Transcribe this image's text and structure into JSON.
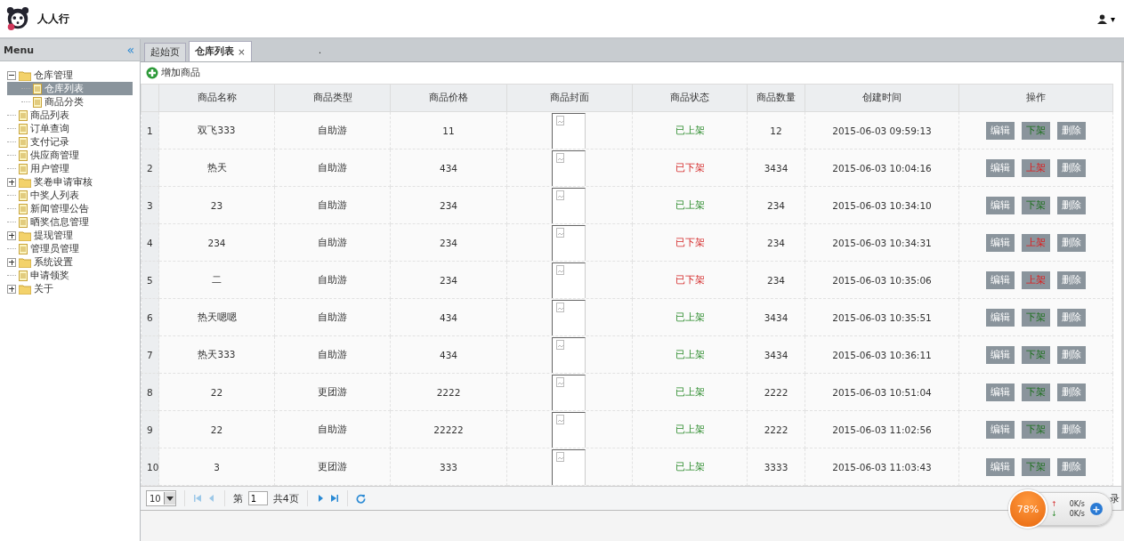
{
  "header": {
    "brand": "人人行",
    "user_caret": "▾"
  },
  "sidebar": {
    "title": "Menu",
    "collapse": "«",
    "tree": [
      {
        "label": "仓库管理",
        "kind": "folder",
        "expanded": true,
        "selected": false,
        "children": [
          {
            "label": "仓库列表",
            "kind": "file",
            "selected": true
          },
          {
            "label": "商品分类",
            "kind": "file",
            "selected": false
          }
        ]
      },
      {
        "label": "商品列表",
        "kind": "file",
        "selected": false
      },
      {
        "label": "订单查询",
        "kind": "file",
        "selected": false
      },
      {
        "label": "支付记录",
        "kind": "file",
        "selected": false
      },
      {
        "label": "供应商管理",
        "kind": "file",
        "selected": false
      },
      {
        "label": "用户管理",
        "kind": "file",
        "selected": false
      },
      {
        "label": "奖卷申请审核",
        "kind": "folder",
        "expanded": false,
        "selected": false
      },
      {
        "label": "中奖人列表",
        "kind": "file",
        "selected": false
      },
      {
        "label": "新闻管理公告",
        "kind": "file",
        "selected": false
      },
      {
        "label": "晒奖信息管理",
        "kind": "file",
        "selected": false
      },
      {
        "label": "提现管理",
        "kind": "folder",
        "expanded": false,
        "selected": false
      },
      {
        "label": "管理员管理",
        "kind": "file",
        "selected": false
      },
      {
        "label": "系统设置",
        "kind": "folder",
        "expanded": false,
        "selected": false
      },
      {
        "label": "申请领奖",
        "kind": "file",
        "selected": false
      },
      {
        "label": "关于",
        "kind": "folder",
        "expanded": false,
        "selected": false
      }
    ]
  },
  "tabs": [
    {
      "label": "起始页",
      "selected": false,
      "closable": false
    },
    {
      "label": "仓库列表",
      "selected": true,
      "closable": true,
      "close": "×"
    }
  ],
  "tab_dot": ".",
  "toolbar": {
    "add": "增加商品"
  },
  "table": {
    "columns": [
      "商品名称",
      "商品类型",
      "商品价格",
      "商品封面",
      "商品状态",
      "商品数量",
      "创建时间",
      "操作"
    ],
    "rows": [
      {
        "index": "1",
        "name": "双飞333",
        "type": "自助游",
        "price": "11",
        "status": "已上架",
        "on_shelf": true,
        "qty": "12",
        "created": "2015-06-03 09:59:13",
        "actions": [
          "编辑",
          "下架",
          "删除"
        ]
      },
      {
        "index": "2",
        "name": "热天",
        "type": "自助游",
        "price": "434",
        "status": "已下架",
        "on_shelf": false,
        "qty": "3434",
        "created": "2015-06-03 10:04:16",
        "actions": [
          "编辑",
          "上架",
          "删除"
        ]
      },
      {
        "index": "3",
        "name": "23",
        "type": "自助游",
        "price": "234",
        "status": "已上架",
        "on_shelf": true,
        "qty": "234",
        "created": "2015-06-03 10:34:10",
        "actions": [
          "编辑",
          "下架",
          "删除"
        ]
      },
      {
        "index": "4",
        "name": "234",
        "type": "自助游",
        "price": "234",
        "status": "已下架",
        "on_shelf": false,
        "qty": "234",
        "created": "2015-06-03 10:34:31",
        "actions": [
          "编辑",
          "上架",
          "删除"
        ]
      },
      {
        "index": "5",
        "name": "二",
        "type": "自助游",
        "price": "234",
        "status": "已下架",
        "on_shelf": false,
        "qty": "234",
        "created": "2015-06-03 10:35:06",
        "actions": [
          "编辑",
          "上架",
          "删除"
        ]
      },
      {
        "index": "6",
        "name": "热天嗯嗯",
        "type": "自助游",
        "price": "434",
        "status": "已上架",
        "on_shelf": true,
        "qty": "3434",
        "created": "2015-06-03 10:35:51",
        "actions": [
          "编辑",
          "下架",
          "删除"
        ]
      },
      {
        "index": "7",
        "name": "热天333",
        "type": "自助游",
        "price": "434",
        "status": "已上架",
        "on_shelf": true,
        "qty": "3434",
        "created": "2015-06-03 10:36:11",
        "actions": [
          "编辑",
          "下架",
          "删除"
        ]
      },
      {
        "index": "8",
        "name": "22",
        "type": "更团游",
        "price": "2222",
        "status": "已上架",
        "on_shelf": true,
        "qty": "2222",
        "created": "2015-06-03 10:51:04",
        "actions": [
          "编辑",
          "下架",
          "删除"
        ]
      },
      {
        "index": "9",
        "name": "22",
        "type": "自助游",
        "price": "22222",
        "status": "已上架",
        "on_shelf": true,
        "qty": "2222",
        "created": "2015-06-03 11:02:56",
        "actions": [
          "编辑",
          "下架",
          "删除"
        ]
      },
      {
        "index": "10",
        "name": "3",
        "type": "更团游",
        "price": "333",
        "status": "已上架",
        "on_shelf": true,
        "qty": "3333",
        "created": "2015-06-03 11:03:43",
        "actions": [
          "编辑",
          "下架",
          "删除"
        ]
      }
    ]
  },
  "pagination": {
    "page_size": "10",
    "page_prefix": "第",
    "page": "1",
    "page_suffix": "共4页",
    "info": "录"
  },
  "speed_widget": {
    "percent": "78%",
    "up_arrow": "↑",
    "up": "0K/s",
    "down_arrow": "↓",
    "down": "0K/s",
    "plus": "+"
  }
}
